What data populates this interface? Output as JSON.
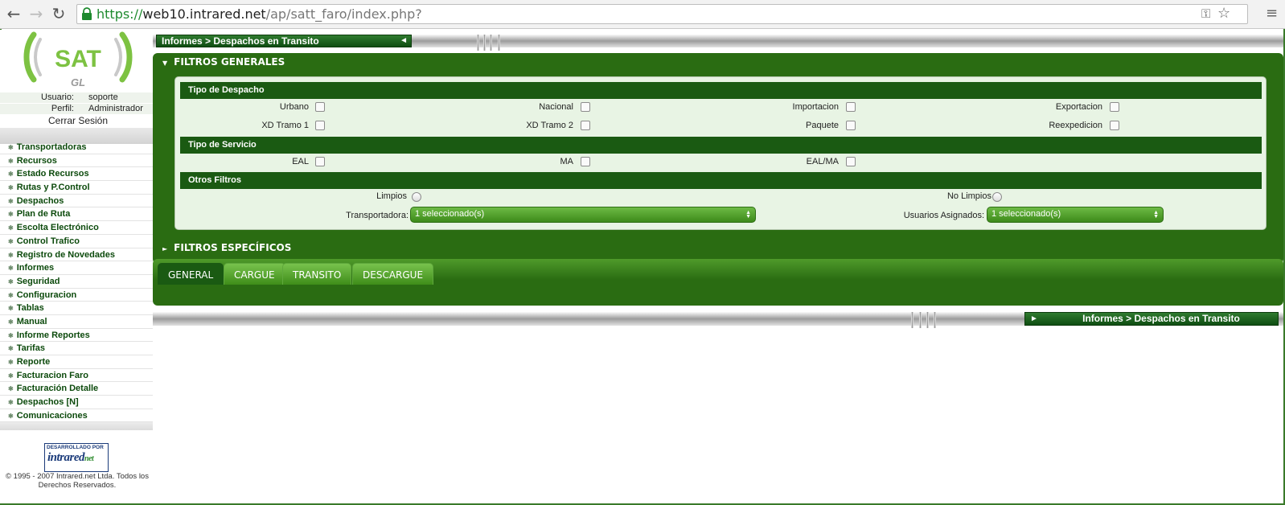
{
  "browser": {
    "url_scheme": "https://",
    "url_host": "web10.intrared.net",
    "url_path": "/ap/satt_faro/index.php?"
  },
  "logo": {
    "title": "SAT",
    "subtitle": "GL"
  },
  "user": {
    "usuario_label": "Usuario:",
    "usuario_value": "soporte",
    "perfil_label": "Perfil:",
    "perfil_value": "Administrador",
    "logout": "Cerrar Sesión"
  },
  "menu": [
    "Transportadoras",
    "Recursos",
    "Estado Recursos",
    "Rutas y P.Control",
    "Despachos",
    "Plan de Ruta",
    "Escolta Electrónico",
    "Control Trafico",
    "Registro de Novedades",
    "Informes",
    "Seguridad",
    "Configuracion",
    "Tablas",
    "Manual",
    "Informe Reportes",
    "Tarifas",
    "Reporte",
    "Facturacion Faro",
    "Facturación Detalle",
    "Despachos [N]",
    "Comunicaciones"
  ],
  "footer": {
    "badge_top": "DESARROLLADO POR",
    "badge_brand": "intrared",
    "badge_net": "net",
    "copyright": "© 1995 - 2007 Intrared.net Ltda. Todos los Derechos Reservados."
  },
  "breadcrumb": "Informes > Despachos en Transito",
  "filtros_generales": {
    "title": "FILTROS GENERALES",
    "tipo_despacho": {
      "title": "Tipo de Despacho",
      "row1": [
        "Urbano",
        "Nacional",
        "Importacion",
        "Exportacion"
      ],
      "row2": [
        "XD Tramo 1",
        "XD Tramo 2",
        "Paquete",
        "Reexpedicion"
      ]
    },
    "tipo_servicio": {
      "title": "Tipo de Servicio",
      "items": [
        "EAL",
        "MA",
        "EAL/MA"
      ]
    },
    "otros": {
      "title": "Otros Filtros",
      "limpios": "Limpios",
      "no_limpios": "No Limpios",
      "transportadora_label": "Transportadora:",
      "transportadora_value": "1 seleccionado(s)",
      "usuarios_label": "Usuarios Asignados:",
      "usuarios_value": "1 seleccionado(s)"
    }
  },
  "filtros_especificos": {
    "title": "FILTROS ESPECÍFICOS"
  },
  "tabs": [
    "GENERAL",
    "CARGUE",
    "TRANSITO",
    "DESCARGUE"
  ],
  "colors": {
    "dark_green": "#1a5a12",
    "panel_green": "#2a6c12",
    "tab_green": "#5fae35"
  }
}
